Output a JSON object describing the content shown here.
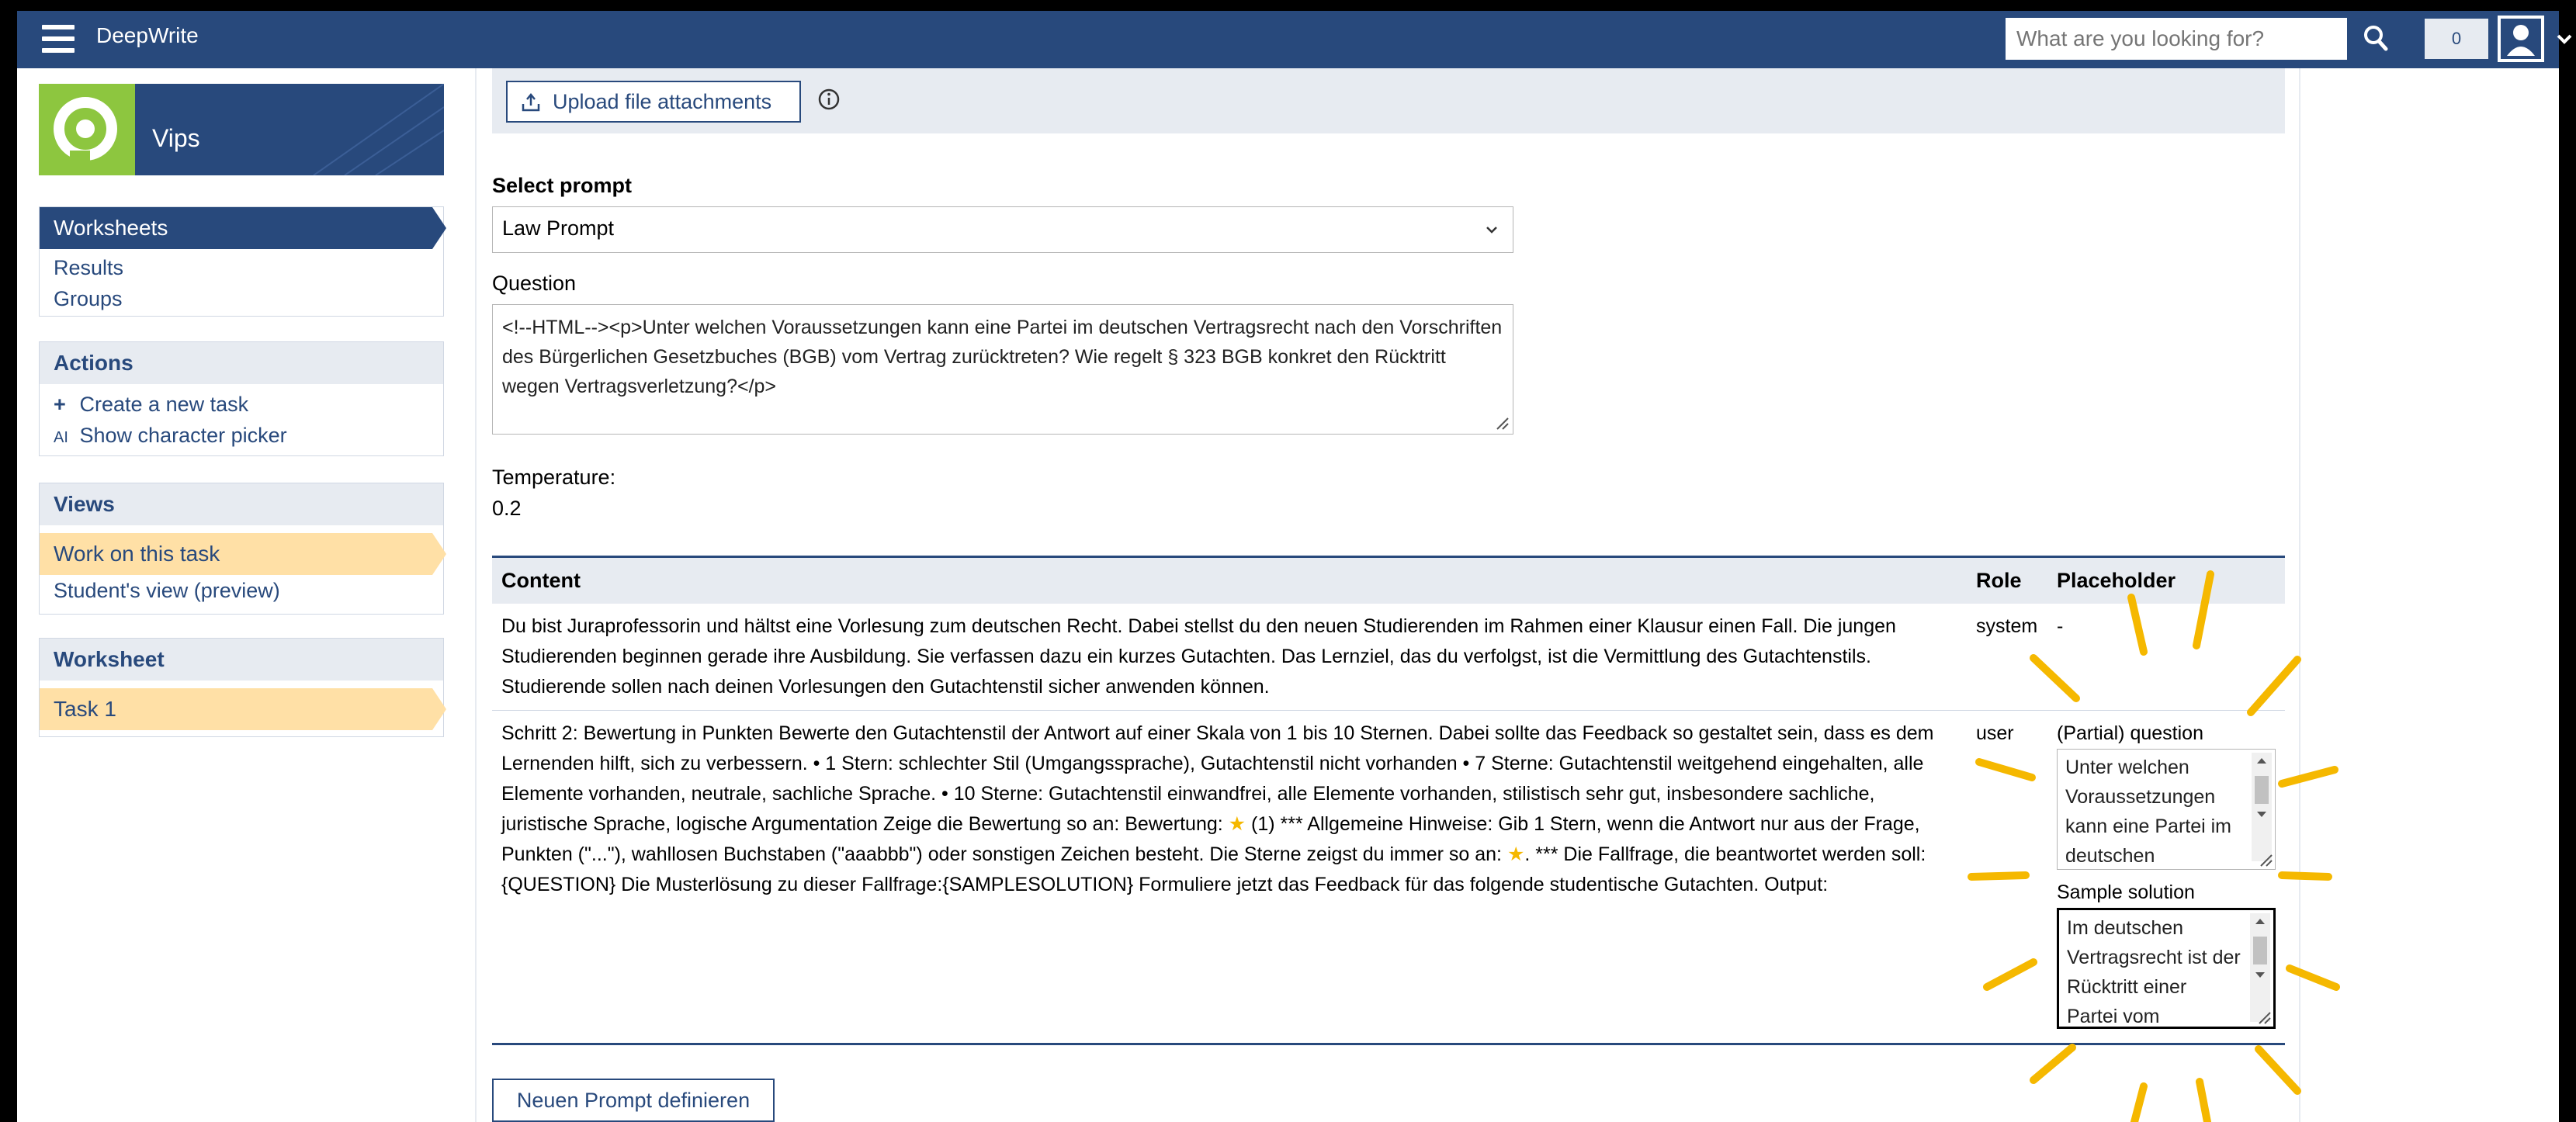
{
  "header": {
    "brand": "DeepWrite",
    "search_placeholder": "What are you looking for?",
    "notification_count": "0"
  },
  "sidebar": {
    "logo_label": "Vips",
    "nav": {
      "active": "Worksheets",
      "items": [
        "Results",
        "Groups"
      ]
    },
    "actions": {
      "heading": "Actions",
      "items": [
        {
          "icon": "+",
          "label": "Create a new task"
        },
        {
          "icon": "AI",
          "label": "Show character picker"
        }
      ]
    },
    "views": {
      "heading": "Views",
      "active": "Work on this task",
      "items": [
        "Student's view (preview)"
      ]
    },
    "worksheet": {
      "heading": "Worksheet",
      "active": "Task 1"
    }
  },
  "main": {
    "upload_label": "Upload file attachments",
    "select_prompt_label": "Select prompt",
    "selected_prompt": "Law Prompt",
    "question_label": "Question",
    "question_text": "<!--HTML--><p>Unter welchen Voraussetzungen kann eine Partei im deutschen Vertragsrecht nach den Vorschriften des Bürgerlichen Gesetzbuches (BGB) vom Vertrag zurücktreten? Wie regelt § 323 BGB konkret den Rücktritt wegen Vertragsverletzung?</p>",
    "temperature_label": "Temperature:",
    "temperature_value": "0.2",
    "table": {
      "headers": {
        "content": "Content",
        "role": "Role",
        "placeholder": "Placeholder"
      },
      "rows": [
        {
          "content": "Du bist Juraprofessorin und hältst eine Vorlesung zum deutschen Recht. Dabei stellst du den neuen Studierenden im Rahmen einer Klausur einen Fall. Die jungen Studierenden beginnen gerade ihre Ausbildung. Sie verfassen dazu ein kurzes Gutachten. Das Lernziel, das du verfolgst, ist die Vermittlung des Gutachtenstils. Studierende sollen nach deinen Vorlesungen den Gutachtenstil sicher anwenden können.",
          "role": "system",
          "placeholder": "-"
        },
        {
          "content_part1": "Schritt 2: Bewertung in Punkten Bewerte den Gutachtenstil der Antwort auf einer Skala von 1 bis 10 Sternen. Dabei sollte das Feedback so gestaltet sein, dass es dem Lernenden hilft, sich zu verbessern. • 1 Stern: schlechter Stil (Umgangssprache), Gutachtenstil nicht vorhanden • 7 Sterne: Gutachtenstil weitgehend eingehalten, alle Elemente vorhanden, neutrale, sachliche Sprache. • 10 Sterne: Gutachtenstil einwandfrei, alle Elemente vorhanden, stilistisch sehr gut, insbesondere sachliche, juristische Sprache, logische Argumentation Zeige die Bewertung so an: Bewertung: ",
          "content_part2": " (1) *** Allgemeine Hinweise: Gib 1 Stern, wenn die Antwort nur aus der Frage, Punkten (\"...\"), wahllosen Buchstaben (\"aaabbb\") oder sonstigen Zeichen besteht. Die Sterne zeigst du immer so an: ",
          "content_part3": ". *** Die Fallfrage, die beantwortet werden soll:{QUESTION} Die Musterlösung zu dieser Fallfrage:{SAMPLESOLUTION} Formuliere jetzt das Feedback für das folgende studentische Gutachten. Output:",
          "role": "user",
          "partial_question_label": "(Partial) question",
          "partial_question_text": "Unter welchen Voraussetzungen kann eine Partei im deutschen",
          "sample_solution_label": "Sample solution",
          "sample_solution_text": "Im deutschen Vertragsrecht ist der Rücktritt einer Partei vom"
        }
      ]
    },
    "new_prompt_button": "Neuen Prompt definieren"
  },
  "colors": {
    "brand_blue": "#28497c",
    "highlight": "#ffe0a6",
    "panel": "#e7ebf1",
    "logo_green": "#8dc63f",
    "annotation": "#f5b800"
  },
  "icons": [
    "hamburger-icon",
    "search-icon",
    "user-icon",
    "chevron-down-icon",
    "upload-icon",
    "info-icon",
    "plus-icon",
    "character-picker-icon",
    "star-icon",
    "resize-grip-icon"
  ]
}
